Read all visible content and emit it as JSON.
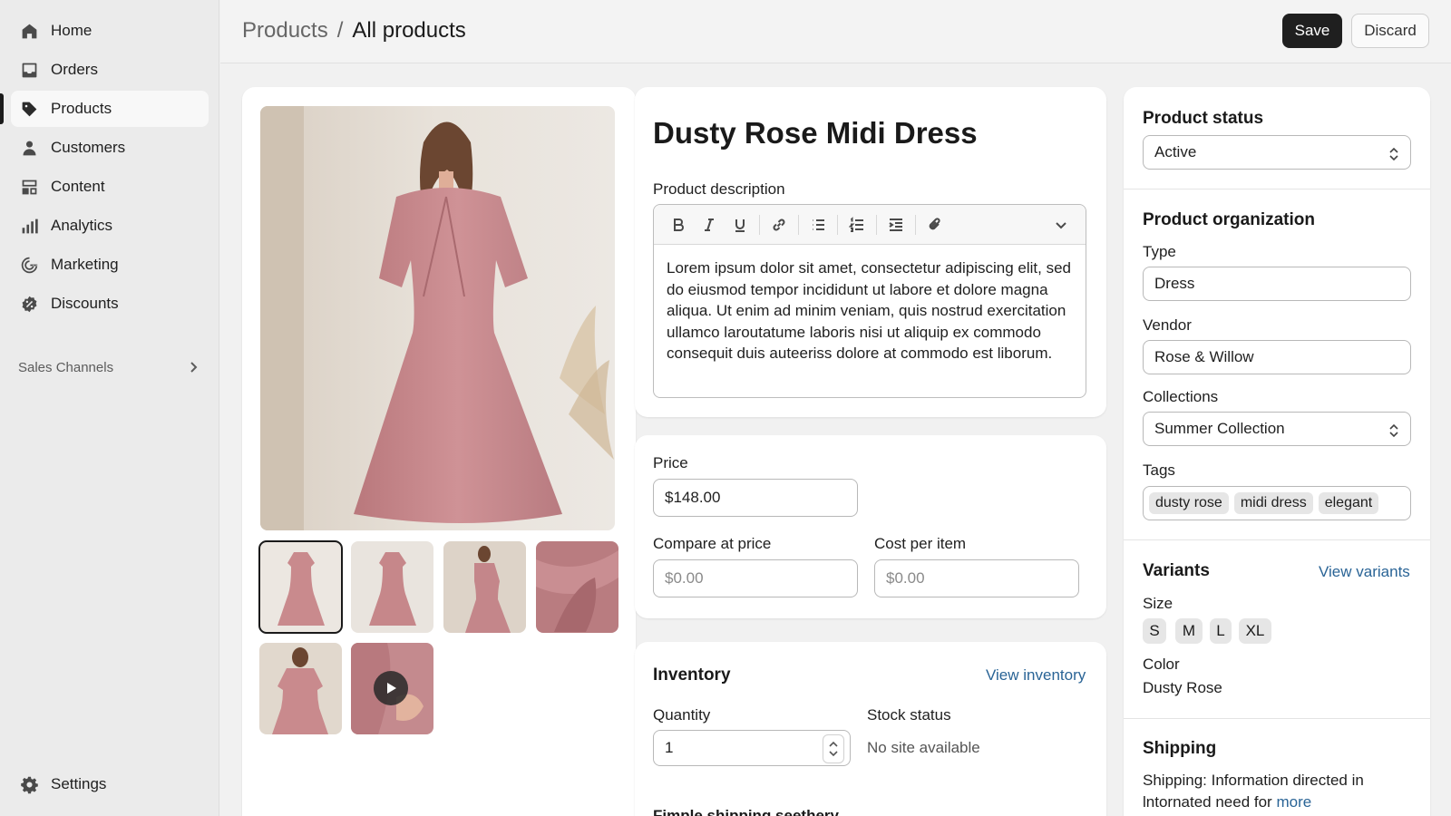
{
  "sidebar": {
    "items": [
      {
        "label": "Home",
        "icon": "home-icon"
      },
      {
        "label": "Orders",
        "icon": "inbox-icon"
      },
      {
        "label": "Products",
        "icon": "tag-icon"
      },
      {
        "label": "Customers",
        "icon": "person-icon"
      },
      {
        "label": "Content",
        "icon": "layout-icon"
      },
      {
        "label": "Analytics",
        "icon": "bar-chart-icon"
      },
      {
        "label": "Marketing",
        "icon": "target-icon"
      },
      {
        "label": "Discounts",
        "icon": "discount-icon"
      }
    ],
    "active": "Products",
    "sales_channels_label": "Sales Channels",
    "settings_label": "Settings"
  },
  "header": {
    "breadcrumb_root": "Products",
    "breadcrumb_sep": "/",
    "breadcrumb_current": "All products",
    "save_label": "Save",
    "discard_label": "Discard"
  },
  "product": {
    "title": "Dusty Rose Midi Dress",
    "description_label": "Product description",
    "description": "Lorem ipsum dolor sit amet, consectetur adipiscing elit, sed do eiusmod tempor incididunt ut labore et dolore magna aliqua. Ut enim ad minim veniam, quis nostrud exercitation ullamco laroutatume laboris nisi ut aliquip ex commodo consequit duis auteeriss dolore at commodo est liborum."
  },
  "pricing": {
    "price_label": "Price",
    "price_value": "$148.00",
    "compare_label": "Compare at price",
    "compare_placeholder": "$0.00",
    "cost_label": "Cost per item",
    "cost_placeholder": "$0.00"
  },
  "inventory": {
    "title": "Inventory",
    "view_link": "View inventory",
    "quantity_label": "Quantity",
    "quantity_value": "1",
    "stock_label": "Stock status",
    "stock_value": "No site available",
    "cut_off_heading": "Fimple shipping seethery"
  },
  "status": {
    "title": "Product status",
    "value": "Active"
  },
  "organization": {
    "title": "Product organization",
    "type_label": "Type",
    "type_value": "Dress",
    "vendor_label": "Vendor",
    "vendor_value": "Rose & Willow",
    "collections_label": "Collections",
    "collections_value": "Summer Collection",
    "tags_label": "Tags",
    "tags": [
      "dusty rose",
      "midi dress",
      "elegant"
    ]
  },
  "variants": {
    "title": "Variants",
    "view_link": "View variants",
    "size_label": "Size",
    "sizes": [
      "S",
      "M",
      "L",
      "XL"
    ],
    "color_label": "Color",
    "color_value": "Dusty Rose"
  },
  "shipping": {
    "title": "Shipping",
    "text_line1": "Shipping: Information directed in",
    "text_line2": "lntornated need for",
    "more_link": "more"
  },
  "colors": {
    "accent_link": "#2a6496",
    "dress": "#c98a8d",
    "primary_button": "#1f1f1f"
  }
}
